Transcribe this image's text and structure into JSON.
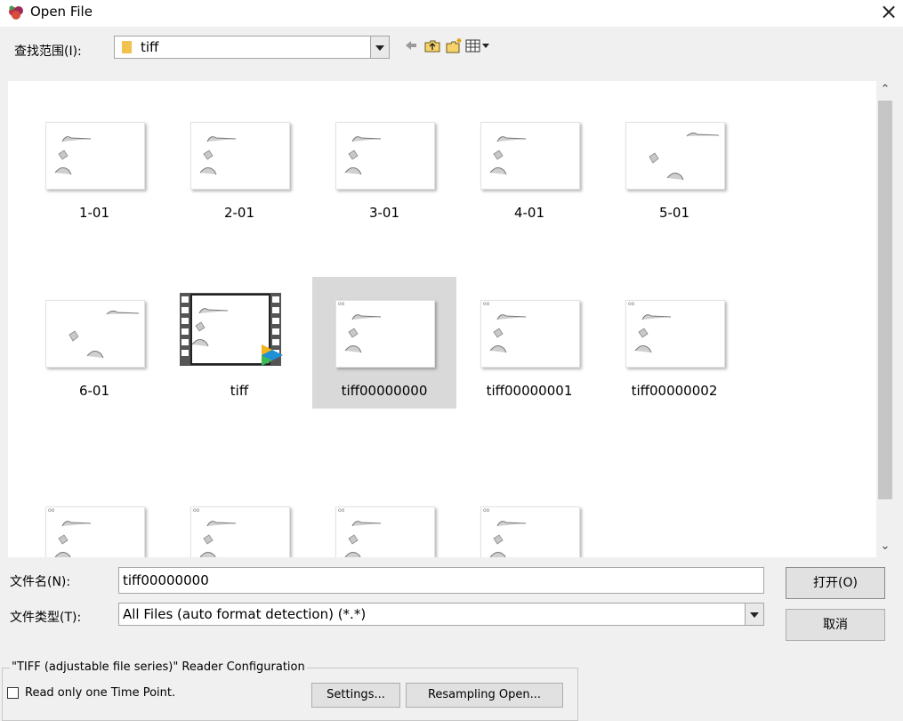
{
  "window": {
    "title": "Open File",
    "close_symbol": "×"
  },
  "lookin": {
    "label": "查找范围(I):",
    "value": "tiff"
  },
  "files": [
    {
      "name": "1-01",
      "kind": "image"
    },
    {
      "name": "2-01",
      "kind": "image"
    },
    {
      "name": "3-01",
      "kind": "image"
    },
    {
      "name": "4-01",
      "kind": "image"
    },
    {
      "name": "5-01",
      "kind": "image"
    },
    {
      "name": "6-01",
      "kind": "image"
    },
    {
      "name": "tiff",
      "kind": "video"
    },
    {
      "name": "tiff00000000",
      "kind": "image",
      "selected": true
    },
    {
      "name": "tiff00000001",
      "kind": "image"
    },
    {
      "name": "tiff00000002",
      "kind": "image"
    },
    {
      "name": "",
      "kind": "image"
    },
    {
      "name": "",
      "kind": "image"
    },
    {
      "name": "",
      "kind": "image"
    },
    {
      "name": "",
      "kind": "image"
    }
  ],
  "filename": {
    "label": "文件名(N):",
    "value": "tiff00000000"
  },
  "filetype": {
    "label": "文件类型(T):",
    "value": "All Files (auto format detection) (*.*)"
  },
  "buttons": {
    "open": "打开(O)",
    "cancel": "取消"
  },
  "reader": {
    "group_label": "\"TIFF (adjustable file series)\" Reader Configuration",
    "checkbox_label": "Read only one Time Point.",
    "settings": "Settings...",
    "resampling": "Resampling Open..."
  },
  "colors": {
    "selection": "#d9d9d9",
    "folder": "#f2c14e",
    "accent": "#1e90d6"
  }
}
